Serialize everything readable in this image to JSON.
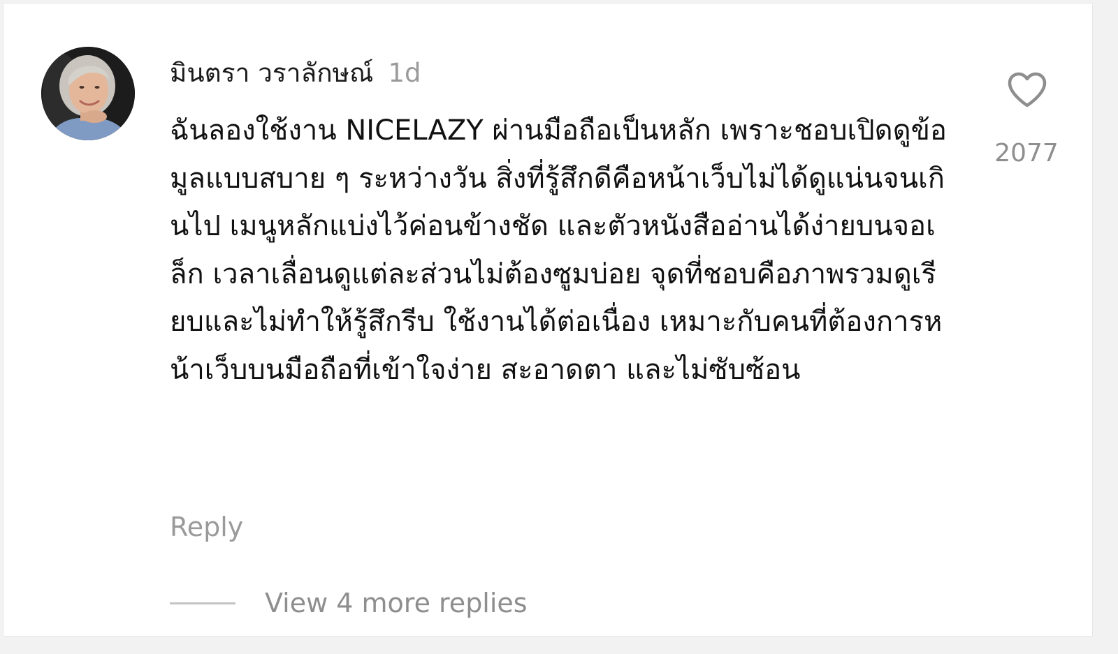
{
  "comment": {
    "username": "มินตรา วราลักษณ์",
    "timestamp": "1d",
    "text": "ฉันลองใช้งาน NICELAZY ผ่านมือถือเป็นหลัก เพราะชอบเปิดดูข้อมูลแบบสบาย ๆ ระหว่างวัน สิ่งที่รู้สึกดีคือหน้าเว็บไม่ได้ดูแน่นจนเกินไป เมนูหลักแบ่งไว้ค่อนข้างชัด และตัวหนังสืออ่านได้ง่ายบนจอเล็ก เวลาเลื่อนดูแต่ละส่วนไม่ต้องซูมบ่อย จุดที่ชอบคือภาพรวมดูเรียบและไม่ทำให้รู้สึกรีบ ใช้งานได้ต่อเนื่อง เหมาะกับคนที่ต้องการหน้าเว็บบนมือถือที่เข้าใจง่าย สะอาดตา และไม่ซับซ้อน",
    "like_count": "2077",
    "like_icon": "heart-outline-icon",
    "reply_label": "Reply",
    "view_replies_label": "View 4 more replies"
  },
  "colors": {
    "text_primary": "#111111",
    "text_muted": "#9a9a9a",
    "divider": "#c4c4c4",
    "background": "#ffffff"
  }
}
